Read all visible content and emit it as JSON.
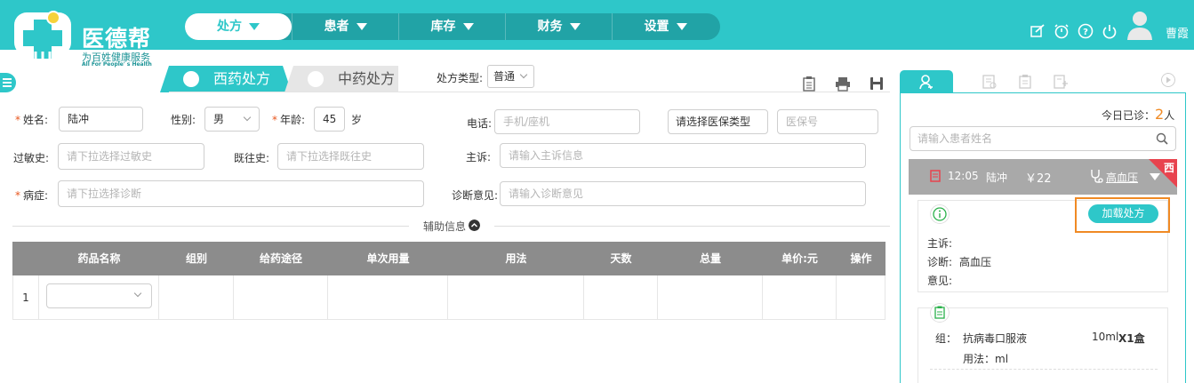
{
  "app": {
    "name": "医德帮",
    "slogan": "为百姓健康服务",
    "slogan_en": "All For People' s Health",
    "brand_color": "#2ec7c9"
  },
  "nav": {
    "items": [
      {
        "label": "处方",
        "active": true
      },
      {
        "label": "患者",
        "active": false
      },
      {
        "label": "库存",
        "active": false
      },
      {
        "label": "财务",
        "active": false
      },
      {
        "label": "设置",
        "active": false
      }
    ]
  },
  "user": {
    "name": "曹霞"
  },
  "top_icons": [
    "edit-icon",
    "timer-icon",
    "help-icon",
    "power-icon"
  ],
  "rx_tabs": {
    "western": "西药处方",
    "chinese": "中药处方",
    "active": "western"
  },
  "rx_type": {
    "label": "处方类型:",
    "value": "普通"
  },
  "toolbar_icons": [
    "clipboard-icon",
    "print-icon",
    "save-icon"
  ],
  "form": {
    "name": {
      "label": "姓名:",
      "value": "陆冲"
    },
    "gender": {
      "label": "性别:",
      "value": "男"
    },
    "age": {
      "label": "年龄:",
      "value": "45",
      "unit": "岁"
    },
    "phone": {
      "label": "电话:",
      "placeholder": "手机/座机"
    },
    "insurance_type": {
      "value": "请选择医保类型"
    },
    "insurance_no": {
      "placeholder": "医保号"
    },
    "allergy": {
      "label": "过敏史:",
      "placeholder": "请下拉选择过敏史"
    },
    "history": {
      "label": "既往史:",
      "placeholder": "请下拉选择既往史"
    },
    "complaint": {
      "label": "主诉:",
      "placeholder": "请输入主诉信息"
    },
    "disease": {
      "label": "病症:",
      "placeholder": "请下拉选择诊断"
    },
    "opinion": {
      "label": "诊断意见:",
      "placeholder": "请输入诊断意见"
    }
  },
  "aux_info": {
    "label": "辅助信息"
  },
  "table": {
    "columns": [
      "",
      "药品名称",
      "组别",
      "给药途径",
      "单次用量",
      "用法",
      "天数",
      "总量",
      "单价:元",
      "操作"
    ],
    "rows": [
      {
        "index": "1"
      }
    ]
  },
  "right_panel": {
    "tab_icons": [
      "doctor-icon",
      "records-icon",
      "clipboard-icon",
      "note-edit-icon"
    ],
    "today_label": "今日已诊：",
    "today_count": "2",
    "today_unit": "人",
    "search_placeholder": "请输入患者姓名",
    "visit": {
      "time": "12:05",
      "name": "陆冲",
      "price": "￥22",
      "diagnosis_link": "高血压",
      "tag": "西"
    },
    "summary": {
      "load_button": "加载处方",
      "complaint_label": "主诉:",
      "complaint": "",
      "diagnosis_label": "诊断:",
      "diagnosis": "高血压",
      "opinion_label": "意见:",
      "opinion": ""
    },
    "prescription": {
      "group_label": "组：",
      "drug": "抗病毒口服液",
      "spec": "10ml",
      "qty": "X1盒",
      "usage": "用法：ml"
    }
  }
}
